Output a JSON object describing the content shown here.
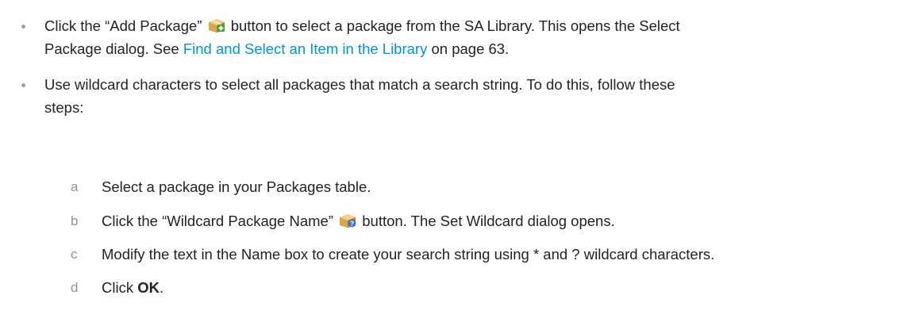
{
  "bullets": [
    {
      "text_before_icon": "Click the “Add Package” ",
      "icon": "add-package-icon",
      "text_after_icon": " button to select a package from the SA Library. This opens the Select",
      "line2_before_link": "Package dialog. See ",
      "link_text": "Find and Select an Item in the Library",
      "line2_after_link": " on page 63."
    },
    {
      "line1": "Use wildcard characters to select all packages that match a search string. To do this, follow these",
      "line2": "steps:"
    }
  ],
  "steps": [
    {
      "letter": "a",
      "text": "Select a package in your Packages table."
    },
    {
      "letter": "b",
      "text_before_icon": "Click the “Wildcard Package Name” ",
      "icon": "wildcard-package-icon",
      "text_after_icon": " button. The Set Wildcard dialog opens."
    },
    {
      "letter": "c",
      "text": "Modify the text in the Name box to create your search string using * and ? wildcard characters."
    },
    {
      "letter": "d",
      "text_before_bold": "Click ",
      "bold": "OK",
      "text_after_bold": "."
    }
  ],
  "colors": {
    "link": "#0096d6",
    "step_letter": "#8c9399",
    "bullet_dot": "#9aa1a8",
    "body_text": "#232323"
  }
}
